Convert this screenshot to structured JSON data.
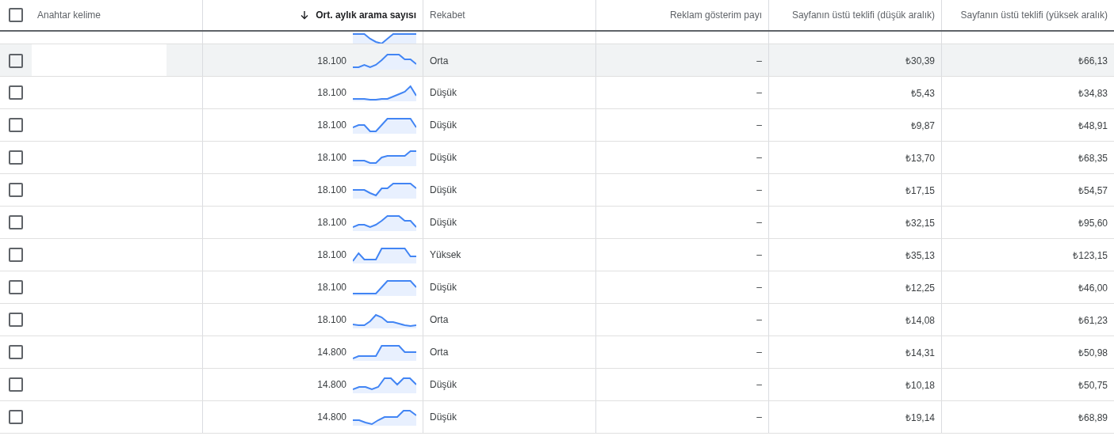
{
  "header": {
    "checked": false,
    "columns": [
      {
        "label": "Anahtar kelime",
        "sorted": false
      },
      {
        "label": "Ort. aylık arama sayısı",
        "sorted": true
      },
      {
        "label": "Rekabet",
        "sorted": false
      },
      {
        "label": "Reklam gösterim payı",
        "sorted": false
      },
      {
        "label": "Sayfanın üstü teklifi (düşük aralık)",
        "sorted": false
      },
      {
        "label": "Sayfanın üstü teklifi (yüksek aralık)",
        "sorted": false
      }
    ]
  },
  "rows": [
    {
      "checked": false,
      "hovered": true,
      "searches": "18.100",
      "competition": "Orta",
      "share": "–",
      "bid_low": "₺30,39",
      "bid_high": "₺66,13"
    },
    {
      "checked": false,
      "hovered": false,
      "searches": "18.100",
      "competition": "Düşük",
      "share": "–",
      "bid_low": "₺5,43",
      "bid_high": "₺34,83"
    },
    {
      "checked": false,
      "hovered": false,
      "searches": "18.100",
      "competition": "Düşük",
      "share": "–",
      "bid_low": "₺9,87",
      "bid_high": "₺48,91"
    },
    {
      "checked": false,
      "hovered": false,
      "searches": "18.100",
      "competition": "Düşük",
      "share": "–",
      "bid_low": "₺13,70",
      "bid_high": "₺68,35"
    },
    {
      "checked": false,
      "hovered": false,
      "searches": "18.100",
      "competition": "Düşük",
      "share": "–",
      "bid_low": "₺17,15",
      "bid_high": "₺54,57"
    },
    {
      "checked": false,
      "hovered": false,
      "searches": "18.100",
      "competition": "Düşük",
      "share": "–",
      "bid_low": "₺32,15",
      "bid_high": "₺95,60"
    },
    {
      "checked": false,
      "hovered": false,
      "searches": "18.100",
      "competition": "Yüksek",
      "share": "–",
      "bid_low": "₺35,13",
      "bid_high": "₺123,15"
    },
    {
      "checked": false,
      "hovered": false,
      "searches": "18.100",
      "competition": "Düşük",
      "share": "–",
      "bid_low": "₺12,25",
      "bid_high": "₺46,00"
    },
    {
      "checked": false,
      "hovered": false,
      "searches": "18.100",
      "competition": "Orta",
      "share": "–",
      "bid_low": "₺14,08",
      "bid_high": "₺61,23"
    },
    {
      "checked": false,
      "hovered": false,
      "searches": "14.800",
      "competition": "Orta",
      "share": "–",
      "bid_low": "₺14,31",
      "bid_high": "₺50,98"
    },
    {
      "checked": false,
      "hovered": false,
      "searches": "14.800",
      "competition": "Düşük",
      "share": "–",
      "bid_low": "₺10,18",
      "bid_high": "₺50,75"
    },
    {
      "checked": false,
      "hovered": false,
      "searches": "14.800",
      "competition": "Düşük",
      "share": "–",
      "bid_low": "₺19,14",
      "bid_high": "₺68,89"
    }
  ]
}
